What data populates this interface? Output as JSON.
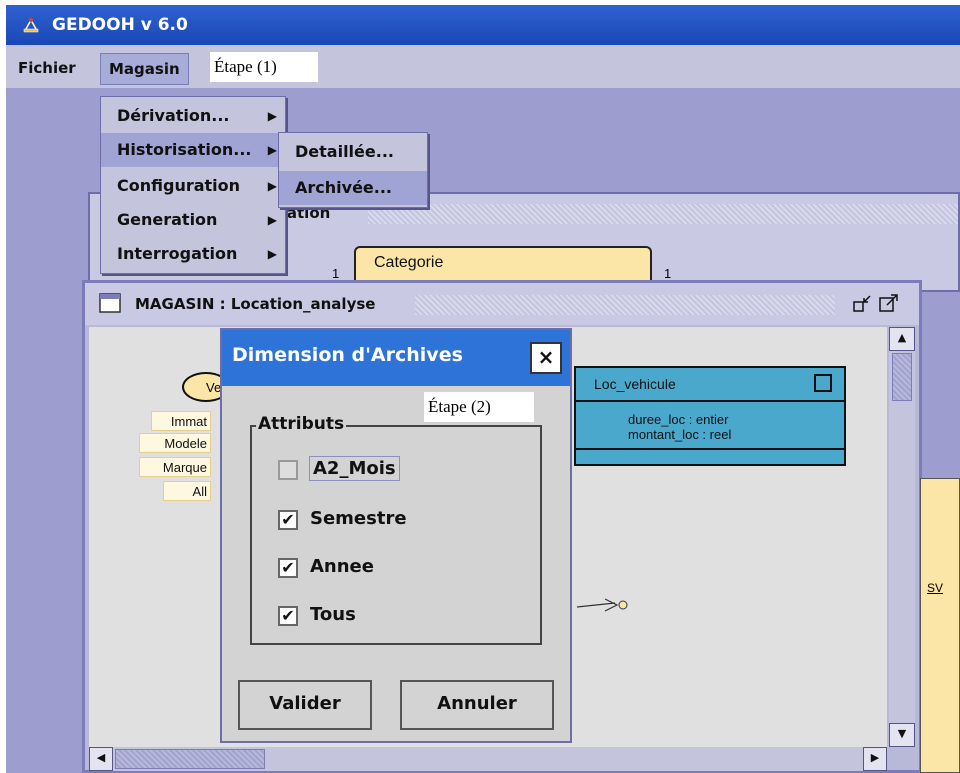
{
  "app": {
    "title": "GEDOOH v 6.0"
  },
  "menubar": {
    "items": [
      "Fichier",
      "Magasin"
    ]
  },
  "annotations": {
    "etape1": "Étape (1)",
    "etape2": "Étape (2)"
  },
  "magasin_menu": {
    "items": [
      {
        "label": "Dérivation..."
      },
      {
        "label": "Historisation..."
      },
      {
        "label": "Configuration"
      },
      {
        "label": "Generation"
      },
      {
        "label": "Interrogation"
      }
    ]
  },
  "historisation_submenu": {
    "items": [
      "Detaillée...",
      "Archivée..."
    ]
  },
  "back_frame": {
    "title": "cation"
  },
  "diagram": {
    "categorie": "Categorie",
    "multiplicity_left": "1",
    "multiplicity_right": "1",
    "ellipse_label": "Ve",
    "attributes": [
      "Immat",
      "Modele",
      "Marque",
      "All"
    ],
    "loc_vehicule": {
      "name": "Loc_vehicule",
      "attrs": [
        "duree_loc : entier",
        "montant_loc : reel"
      ]
    },
    "right_label": "SV"
  },
  "front_frame": {
    "title": "MAGASIN : Location_analyse"
  },
  "dialog": {
    "title": "Dimension d'Archives",
    "close": "×",
    "group_label": "Attributs",
    "options": [
      {
        "label": "A2_Mois",
        "checked": false
      },
      {
        "label": "Semestre",
        "checked": true
      },
      {
        "label": "Annee",
        "checked": true
      },
      {
        "label": "Tous",
        "checked": true
      }
    ],
    "validate": "Valider",
    "cancel": "Annuler"
  }
}
